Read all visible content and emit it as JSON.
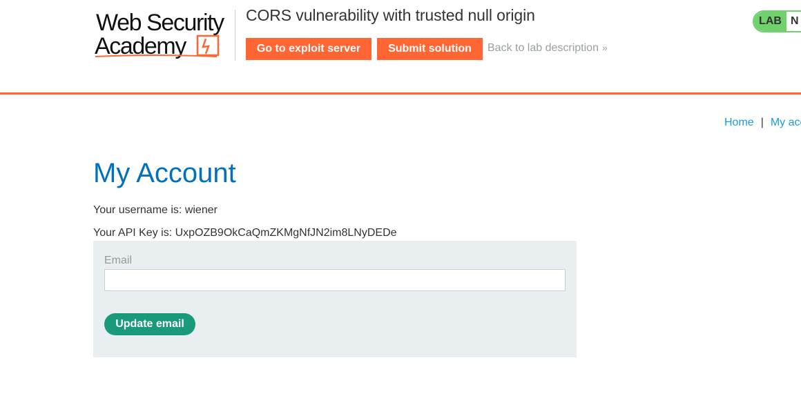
{
  "header": {
    "logo_alt": "Web Security Academy",
    "lab_title": "CORS vulnerability with trusted null origin",
    "exploit_button": "Go to exploit server",
    "submit_button": "Submit solution",
    "back_link": "Back to lab description",
    "back_link_chevron": "»",
    "status_label": "LAB",
    "status_state": "N",
    "accent_color": "#ff6633",
    "status_color": "#70d16d"
  },
  "nav": {
    "home": "Home",
    "separator": "|",
    "my_account": "My acc"
  },
  "main": {
    "heading": "My Account",
    "username_line": "Your username is: wiener",
    "api_key_line": "Your API Key is: UxpOZB9OkCaQmZKMgNfJN2im8LNyDEDe",
    "form": {
      "email_label": "Email",
      "email_value": "",
      "email_placeholder": "",
      "update_button": "Update email"
    }
  }
}
